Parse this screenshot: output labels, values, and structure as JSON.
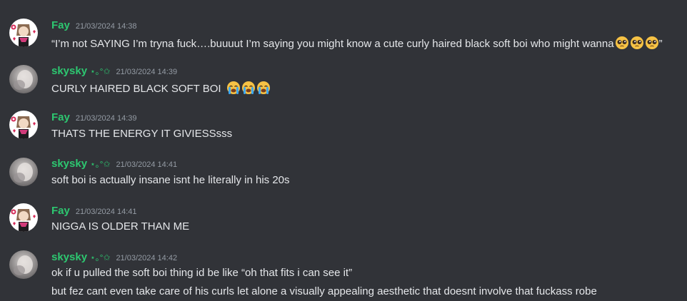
{
  "messages": [
    {
      "author": "Fay",
      "author_decoration": "",
      "avatar": "fay-avatar",
      "timestamp": "21/03/2024 14:38",
      "lines": [
        "“I’m not SAYING I’m tryna fuck….buuuut I’m saying you might know a cute curly haired black soft boi who might wanna"
      ],
      "line_suffix": "”",
      "emojis": [
        "pleading-face-emoji",
        "pleading-face-emoji",
        "pleading-face-emoji"
      ]
    },
    {
      "author": "skysky",
      "author_decoration": "⋆｡°✩",
      "avatar": "skysky-avatar",
      "timestamp": "21/03/2024 14:39",
      "lines": [
        "CURLY HAIRED BLACK SOFT BOI"
      ],
      "emojis": [
        "loudly-crying-face-emoji",
        "loudly-crying-face-emoji",
        "loudly-crying-face-emoji"
      ]
    },
    {
      "author": "Fay",
      "author_decoration": "",
      "avatar": "fay-avatar",
      "timestamp": "21/03/2024 14:39",
      "lines": [
        "THATS THE ENERGY IT GIVIESSsss"
      ]
    },
    {
      "author": "skysky",
      "author_decoration": "⋆｡°✩",
      "avatar": "skysky-avatar",
      "timestamp": "21/03/2024 14:41",
      "lines": [
        "soft boi is actually insane isnt he literally in his 20s"
      ]
    },
    {
      "author": "Fay",
      "author_decoration": "",
      "avatar": "fay-avatar",
      "timestamp": "21/03/2024 14:41",
      "lines": [
        "NIGGA IS OLDER THAN ME"
      ]
    },
    {
      "author": "skysky",
      "author_decoration": "⋆｡°✩",
      "avatar": "skysky-avatar",
      "timestamp": "21/03/2024 14:42",
      "lines": [
        "ok if u pulled the soft boi thing id be like “oh that fits i can see it”",
        "but fez cant even take care of his curls let alone a visually appealing aesthetic that doesnt involve that fuckass robe"
      ]
    }
  ],
  "colors": {
    "background": "#313338",
    "username": "#2dc770",
    "timestamp": "#949ba4",
    "text": "#e5e7ea"
  }
}
